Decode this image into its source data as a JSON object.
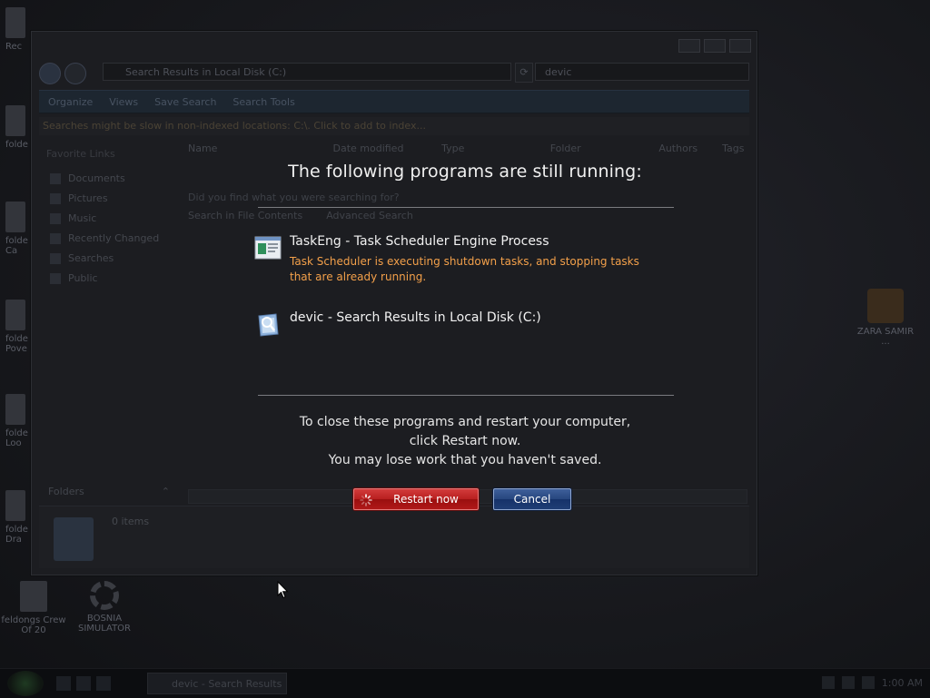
{
  "desktop": {
    "icons": [
      {
        "label": "Rec"
      },
      {
        "label": "folde"
      },
      {
        "label": "folde Ca"
      },
      {
        "label": "folde Pove"
      },
      {
        "label": "folde Loo"
      },
      {
        "label": "folde Dra"
      },
      {
        "label": "feldongs Crew Of 20"
      },
      {
        "label": "BOSNIA SIMULATOR"
      },
      {
        "label": "ZARA SAMIR ..."
      }
    ]
  },
  "explorer": {
    "address": "Search Results in Local Disk (C:)",
    "search_value": "devic",
    "toolbar": [
      "Organize",
      "Views",
      "Save Search",
      "Search Tools"
    ],
    "info_bar": "Searches might be slow in non-indexed locations: C:\\. Click to add to index...",
    "columns": [
      "Name",
      "Date modified",
      "Type",
      "Folder",
      "Authors",
      "Tags"
    ],
    "sidebar_heading": "Favorite Links",
    "sidebar_items": [
      "Documents",
      "Pictures",
      "Music",
      "Recently Changed",
      "Searches",
      "Public"
    ],
    "no_find_text": "Did you find what you were searching for?",
    "search_in_file_contents": "Search in File Contents",
    "advanced_search": "Advanced Search",
    "folders_label": "Folders",
    "item_count": "0 items"
  },
  "dialog": {
    "heading": "The following programs are still running:",
    "programs": [
      {
        "name": "TaskEng - Task Scheduler Engine Process",
        "description": "Task Scheduler is executing shutdown tasks, and stopping tasks that are already running.",
        "icon": "task-scheduler-icon"
      },
      {
        "name": "devic - Search Results in Local Disk (C:)",
        "description": "",
        "icon": "search-folder-icon"
      }
    ],
    "message_line1": "To close these programs and restart your computer,",
    "message_line2": "click Restart now.",
    "message_line3": "You may lose work that you haven't saved.",
    "restart_label": "Restart now",
    "cancel_label": "Cancel",
    "colors": {
      "description": "#f3a04a",
      "restart": "#b81f1f",
      "cancel": "#27467e"
    }
  },
  "taskbar": {
    "task_label": "devic - Search Results ...",
    "clock": "1:00 AM"
  }
}
